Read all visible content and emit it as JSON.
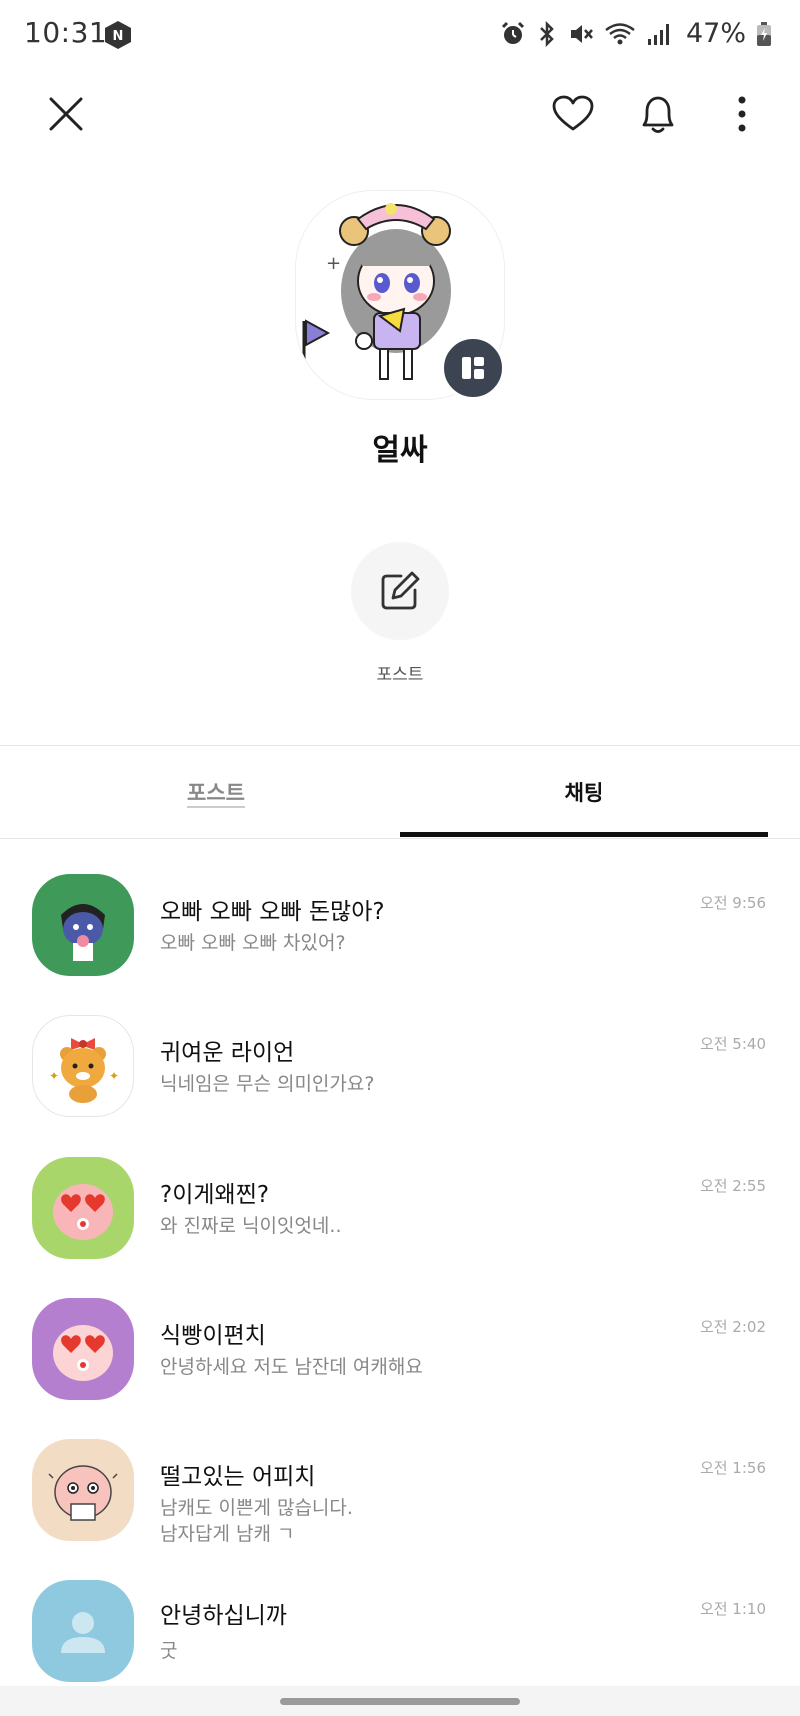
{
  "status_bar": {
    "time": "10:31",
    "battery": "47%",
    "icons": [
      "navi-n-icon",
      "alarm-icon",
      "bluetooth-icon",
      "mute-icon",
      "wifi-icon",
      "signal-icon",
      "battery-icon"
    ]
  },
  "header": {
    "icons": [
      "close-icon",
      "heart-icon",
      "bell-icon",
      "more-vertical-icon"
    ]
  },
  "profile": {
    "name": "얼싸",
    "badge_icon": "profile-switch-icon"
  },
  "post_action": {
    "label": "포스트",
    "icon": "edit-icon"
  },
  "tabs": [
    {
      "label": "포스트",
      "active": false
    },
    {
      "label": "채팅",
      "active": true
    }
  ],
  "chats": [
    {
      "name": "오빠 오빠 오빠 돈많아?",
      "message": "오빠 오빠 오빠 차있어?",
      "time": "오전 9:56",
      "avatar_color": "#3f9a5a"
    },
    {
      "name": "귀여운 라이언",
      "message": "닉네임은 무슨 의미인가요?",
      "time": "오전 5:40",
      "avatar_color": "#ffffff"
    },
    {
      "name": "?이게왜찐?",
      "message": "와 진짜로 닉이잇엇네..",
      "time": "오전 2:55",
      "avatar_color": "#a8d66b"
    },
    {
      "name": "식빵이편치",
      "message": "안녕하세요 저도 남잔데 여캐해요",
      "time": "오전 2:02",
      "avatar_color": "#b57fd0"
    },
    {
      "name": "떨고있는 어피치",
      "message": "남캐도 이쁜게 많습니다.",
      "message2": "남자답게 남캐 ㄱ",
      "time": "오전 1:56",
      "avatar_color": "#f3dcc4"
    },
    {
      "name": "안녕하십니까",
      "message": "굿",
      "time": "오전 1:10",
      "avatar_color": "#8fc9e0"
    }
  ],
  "colors": {
    "text_primary": "#111111",
    "text_secondary": "#888888",
    "badge_bg": "#3d4451",
    "tab_indicator": "#111111"
  }
}
